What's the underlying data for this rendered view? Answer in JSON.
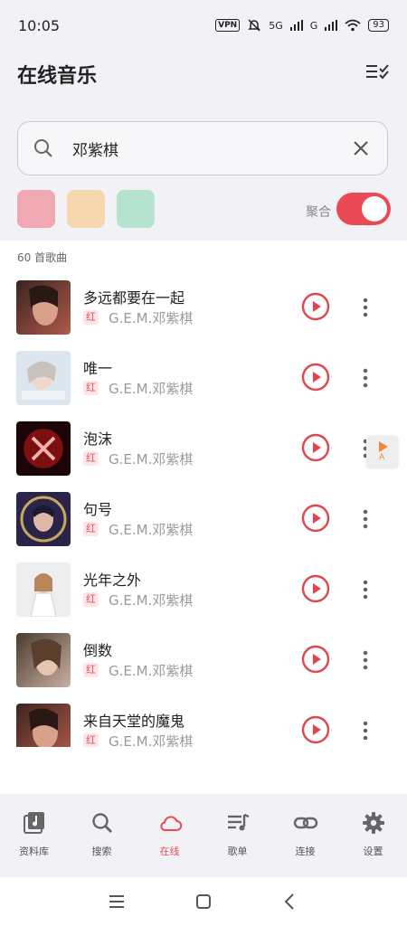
{
  "status_bar": {
    "time": "10:05",
    "vpn": "VPN",
    "signal1": "5G",
    "signal2": "G",
    "battery": "93"
  },
  "header": {
    "title": "在线音乐"
  },
  "search": {
    "query": "邓紫棋"
  },
  "filters": {
    "swatch_colors": [
      "#f0a8b3",
      "#f6d6ad",
      "#b6e3cf"
    ],
    "merge_label": "聚合",
    "merge_enabled": true
  },
  "list": {
    "count_label": "60 首歌曲",
    "songs": [
      {
        "title": "多远都要在一起",
        "tag": "红",
        "artist": "G.E.M.邓紫棋"
      },
      {
        "title": "唯一",
        "tag": "红",
        "artist": "G.E.M.邓紫棋"
      },
      {
        "title": "泡沫",
        "tag": "红",
        "artist": "G.E.M.邓紫棋"
      },
      {
        "title": "句号",
        "tag": "红",
        "artist": "G.E.M.邓紫棋"
      },
      {
        "title": "光年之外",
        "tag": "红",
        "artist": "G.E.M.邓紫棋"
      },
      {
        "title": "倒数",
        "tag": "红",
        "artist": "G.E.M.邓紫棋"
      },
      {
        "title": "来自天堂的魔鬼",
        "tag": "红",
        "artist": "G.E.M.邓紫棋"
      }
    ]
  },
  "float_button": {
    "label": "A"
  },
  "nav": {
    "items": [
      {
        "label": "资料库",
        "icon": "library-icon"
      },
      {
        "label": "搜索",
        "icon": "search-icon"
      },
      {
        "label": "在线",
        "icon": "cloud-icon",
        "active": true
      },
      {
        "label": "歌单",
        "icon": "playlist-icon"
      },
      {
        "label": "连接",
        "icon": "link-icon"
      },
      {
        "label": "设置",
        "icon": "gear-icon"
      }
    ]
  },
  "colors": {
    "accent": "#ea4a55",
    "background": "#f2f2f6"
  }
}
